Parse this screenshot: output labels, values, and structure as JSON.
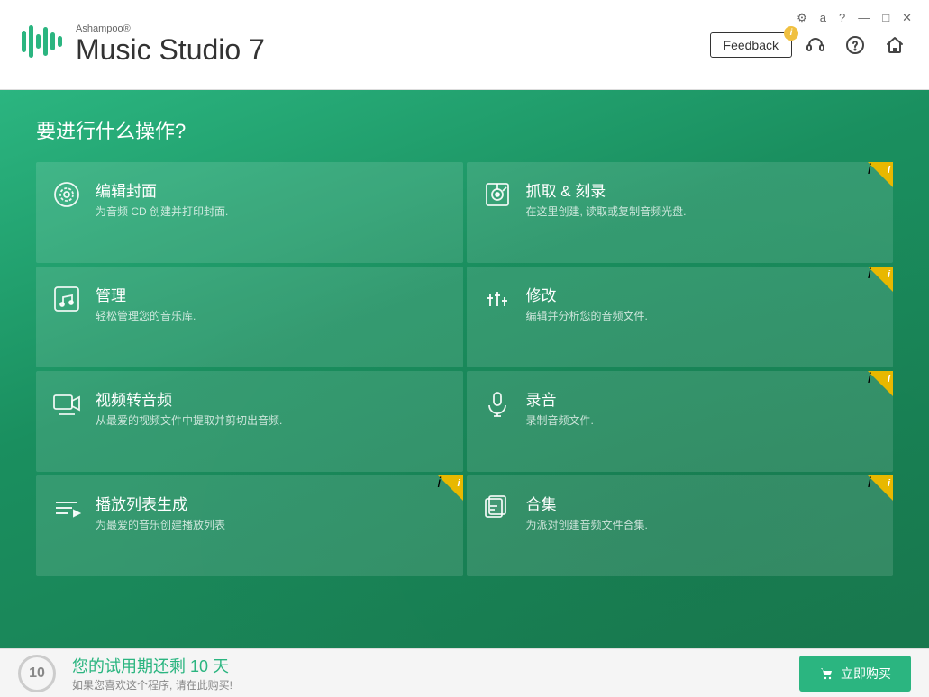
{
  "titleBar": {
    "brand": "Ashampoo®",
    "appName": "Music Studio 7",
    "feedbackLabel": "Feedback",
    "windowControls": {
      "settings": "⚙",
      "account": "a",
      "help": "?",
      "minimize": "—",
      "maximize": "□",
      "close": "✕"
    }
  },
  "mainContent": {
    "pageTitle": "要进行什么操作?",
    "cells": [
      {
        "id": "edit-cover",
        "title": "编辑封面",
        "desc": "为音频 CD 创建并打印封面.",
        "hasBadge": false,
        "iconType": "disc"
      },
      {
        "id": "rip-burn",
        "title": "抓取 & 刻录",
        "desc": "在这里创建, 读取或复制音频光盘.",
        "hasBadge": true,
        "iconType": "burn"
      },
      {
        "id": "manage",
        "title": "管理",
        "desc": "轻松管理您的音乐库.",
        "hasBadge": false,
        "iconType": "music-note"
      },
      {
        "id": "modify",
        "title": "修改",
        "desc": "编辑并分析您的音频文件.",
        "hasBadge": true,
        "iconType": "equalizer"
      },
      {
        "id": "video-to-audio",
        "title": "视频转音频",
        "desc": "从最爱的视频文件中提取并剪切出音频.",
        "hasBadge": false,
        "iconType": "video"
      },
      {
        "id": "record",
        "title": "录音",
        "desc": "录制音频文件.",
        "hasBadge": true,
        "iconType": "microphone"
      },
      {
        "id": "playlist",
        "title": "播放列表生成",
        "desc": "为最爱的音乐创建播放列表",
        "hasBadge": true,
        "iconType": "playlist"
      },
      {
        "id": "compilation",
        "title": "合集",
        "desc": "为派对创建音频文件合集.",
        "hasBadge": true,
        "iconType": "compilation"
      }
    ]
  },
  "bottomBar": {
    "trialDays": "10",
    "trialMainText": "您的试用期还剩 10 天",
    "trialSubText": "如果您喜欢这个程序, 请在此购买!",
    "buyLabel": "立即购买"
  }
}
